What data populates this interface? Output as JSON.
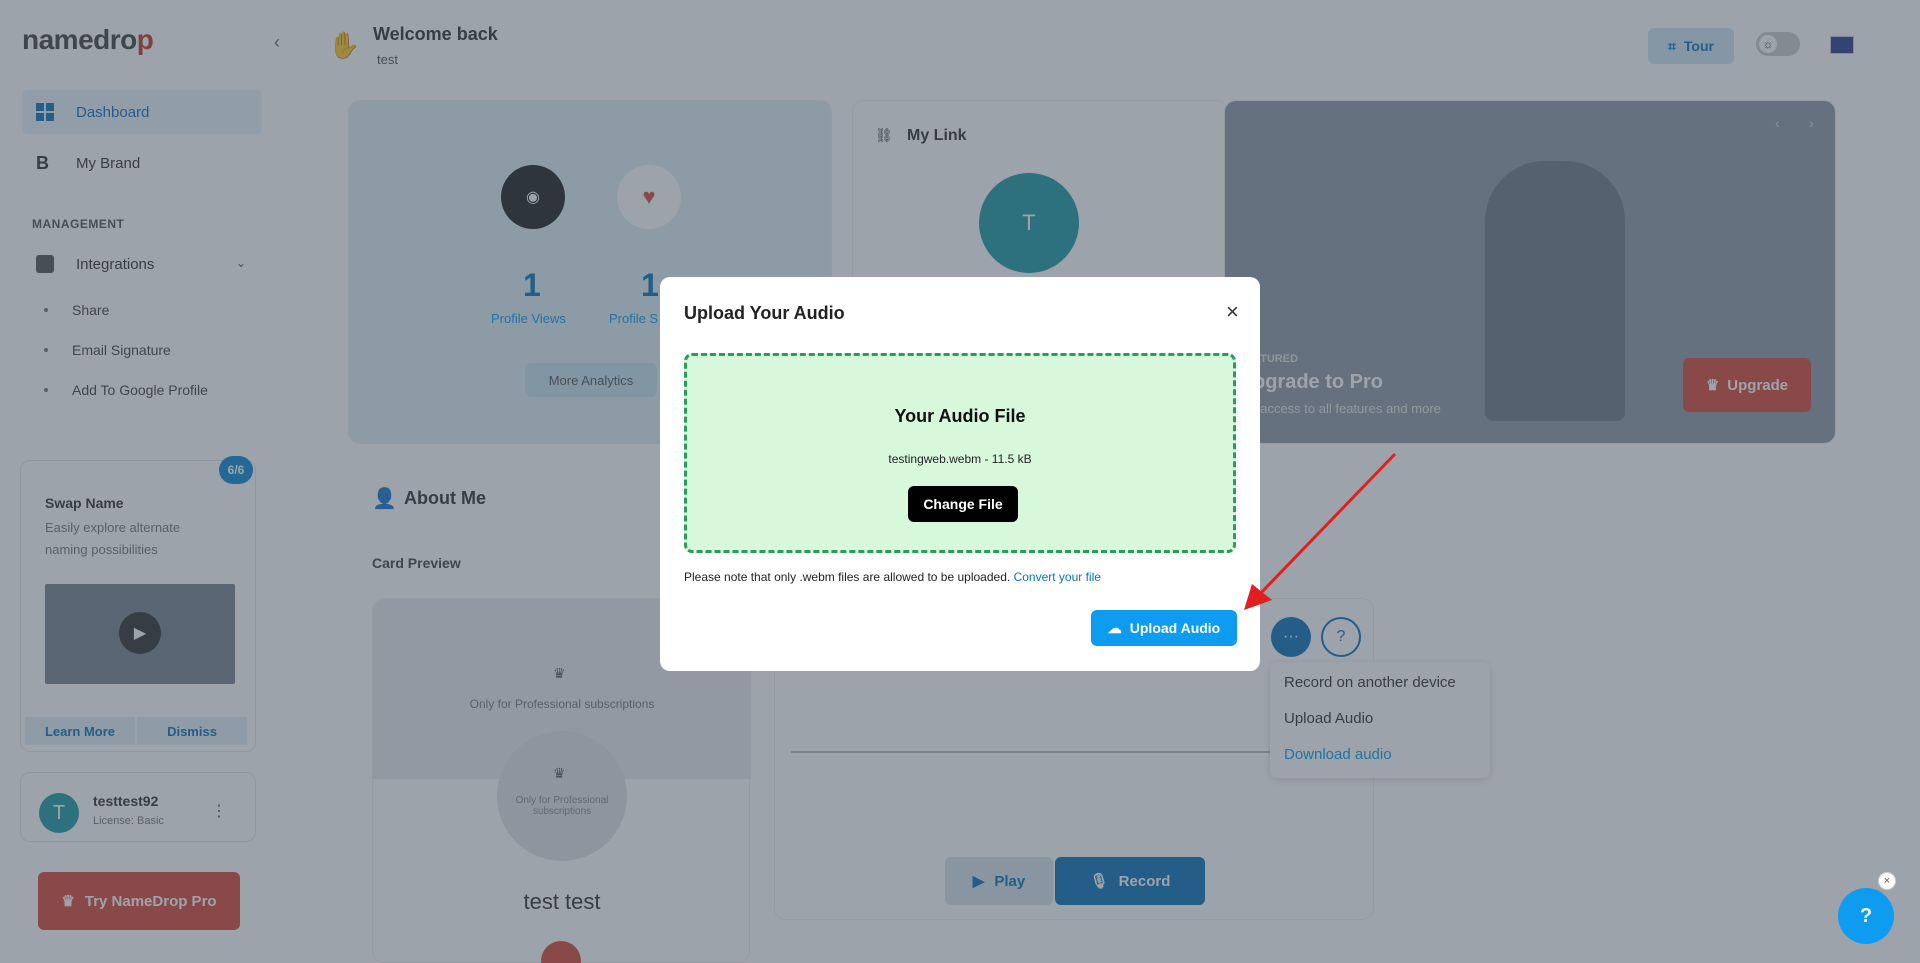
{
  "app": {
    "logo_a": "namedro",
    "logo_b": "p",
    "collapse": "‹"
  },
  "header": {
    "greeting": "Welcome back",
    "user": "test",
    "tour_label": "Tour"
  },
  "sidebar": {
    "items": [
      {
        "label": "Dashboard"
      },
      {
        "label": "My Brand"
      }
    ],
    "section_label": "MANAGEMENT",
    "integrations": "Integrations",
    "subitems": [
      {
        "label": "Share"
      },
      {
        "label": "Email Signature"
      },
      {
        "label": "Add To Google Profile"
      }
    ],
    "swap": {
      "badge": "6/6",
      "title": "Swap Name",
      "desc": "Easily explore alternate naming possibilities",
      "learn_more": "Learn More",
      "dismiss": "Dismiss"
    },
    "user": {
      "initial": "T",
      "name": "testtest92",
      "license": "License: Basic"
    },
    "try_pro": "Try NameDrop Pro"
  },
  "stats": {
    "views_value": "1",
    "views_label": "Profile Views",
    "likes_value": "1",
    "likes_label": "Profile S",
    "more": "More Analytics"
  },
  "mylink": {
    "title": "My Link",
    "initial": "T"
  },
  "promo": {
    "featured": "ATURED",
    "title": "pgrade to Pro",
    "desc": "t access to all features and more",
    "upgrade": "Upgrade"
  },
  "about": {
    "title": "About Me",
    "card_preview": "Card Preview",
    "pro_only": "Only for Professional subscriptions",
    "pro_only2": "Only for Professional subscriptions",
    "name": "test test"
  },
  "audio_menu": {
    "items": [
      "Record on another device",
      "Upload Audio",
      "Download audio"
    ],
    "play": "Play",
    "record": "Record"
  },
  "modal": {
    "title": "Upload Your Audio",
    "close": "×",
    "file_heading": "Your Audio File",
    "file_info": "testingweb.webm - 11.5 kB",
    "change_file": "Change File",
    "note": "Please note that only .webm files are allowed to be uploaded.",
    "convert_link": "Convert your file",
    "upload_button": "Upload Audio"
  },
  "colors": {
    "accent": "#0d9cf0",
    "brand_red": "#d84a3c",
    "dropzone_border": "#2a9d5c",
    "dropzone_bg": "#d8f8dc",
    "arrow": "#e02020"
  }
}
